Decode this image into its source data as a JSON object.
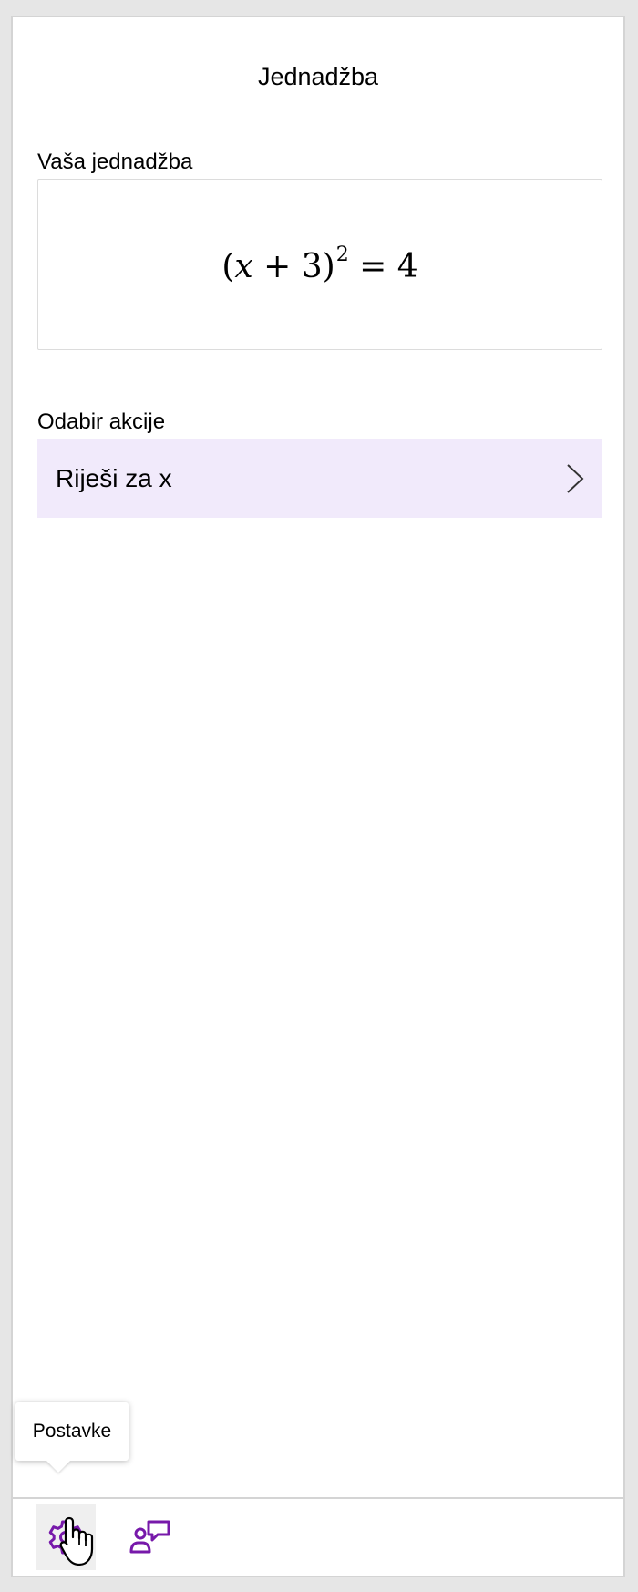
{
  "pane": {
    "title": "Jednadžba",
    "equation_label": "Vaša jednadžba",
    "equation": {
      "open_paren": "(",
      "variable": "x",
      "operator": " + ",
      "constant": "3",
      "close_paren": ")",
      "exponent": "2",
      "equals": " = ",
      "rhs": "4"
    },
    "action_label": "Odabir akcije",
    "action": {
      "label": "Riješi za x",
      "icon": "chevron-right-icon"
    }
  },
  "toolbar": {
    "settings": {
      "icon": "gear-icon",
      "tooltip": "Postavke"
    },
    "feedback": {
      "icon": "person-feedback-icon"
    }
  },
  "colors": {
    "accent": "#7719aa",
    "action_bg": "#f1eafb",
    "border": "#d4d4d4"
  }
}
